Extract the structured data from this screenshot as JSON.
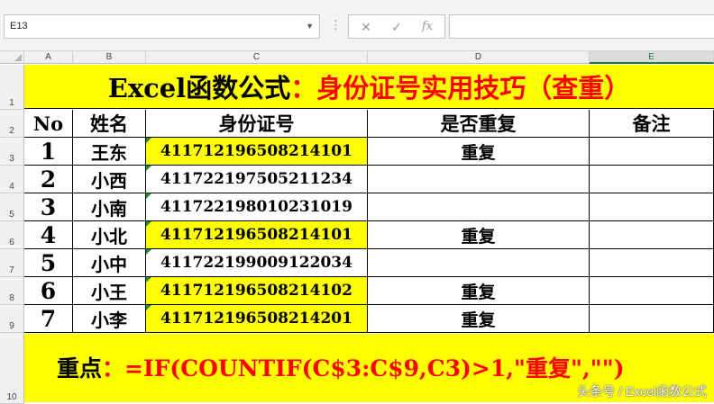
{
  "formula_bar": {
    "name_box": "E13",
    "cancel_icon": "✕",
    "enter_icon": "✓",
    "fx_label": "fx",
    "formula": ""
  },
  "columns": [
    "A",
    "B",
    "C",
    "D",
    "E"
  ],
  "selected_column": "E",
  "rows": [
    "1",
    "2",
    "3",
    "4",
    "5",
    "6",
    "7",
    "8",
    "9",
    "10"
  ],
  "title": {
    "part1": "Excel函数公式",
    "colon": "：",
    "part2": "身份证号实用技巧（查重）"
  },
  "table": {
    "headers": [
      "No",
      "姓名",
      "身份证号",
      "是否重复",
      "备注"
    ],
    "rows": [
      {
        "no": "1",
        "name": "王东",
        "id": "411712196508214101",
        "dup": "重复",
        "note": "",
        "highlight": true
      },
      {
        "no": "2",
        "name": "小西",
        "id": "411722197505211234",
        "dup": "",
        "note": "",
        "highlight": false
      },
      {
        "no": "3",
        "name": "小南",
        "id": "411722198010231019",
        "dup": "",
        "note": "",
        "highlight": false
      },
      {
        "no": "4",
        "name": "小北",
        "id": "411712196508214101",
        "dup": "重复",
        "note": "",
        "highlight": true
      },
      {
        "no": "5",
        "name": "小中",
        "id": "411722199009122034",
        "dup": "",
        "note": "",
        "highlight": false
      },
      {
        "no": "6",
        "name": "小王",
        "id": "411712196508214102",
        "dup": "重复",
        "note": "",
        "highlight": true
      },
      {
        "no": "7",
        "name": "小李",
        "id": "411712196508214201",
        "dup": "重复",
        "note": "",
        "highlight": true
      }
    ]
  },
  "footer": {
    "label": "重点",
    "colon": "：",
    "formula": "=IF(COUNTIF(C$3:C$9,C3)>1,\"重复\",\"\")"
  },
  "watermark": "头条号 / Excel函数公式",
  "colors": {
    "highlight": "#ffff00",
    "accent_red": "#ff0000",
    "excel_green": "#217346"
  }
}
